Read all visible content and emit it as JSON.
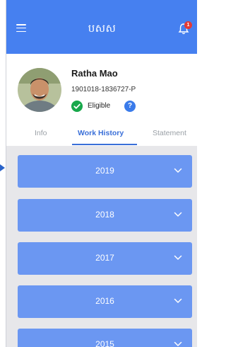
{
  "header": {
    "title": "បសស",
    "notification_count": "1"
  },
  "profile": {
    "name": "Ratha Mao",
    "id_number": "1901018-1836727-P",
    "status": "Eligible",
    "help": "?"
  },
  "tabs": [
    {
      "label": "Info",
      "active": false
    },
    {
      "label": "Work History",
      "active": true
    },
    {
      "label": "Statement",
      "active": false
    }
  ],
  "years": [
    "2019",
    "2018",
    "2017",
    "2016",
    "2015"
  ],
  "colors": {
    "primary": "#4680f0",
    "card": "#6b97f2",
    "eligible": "#18a84b",
    "badge": "#e53935"
  }
}
